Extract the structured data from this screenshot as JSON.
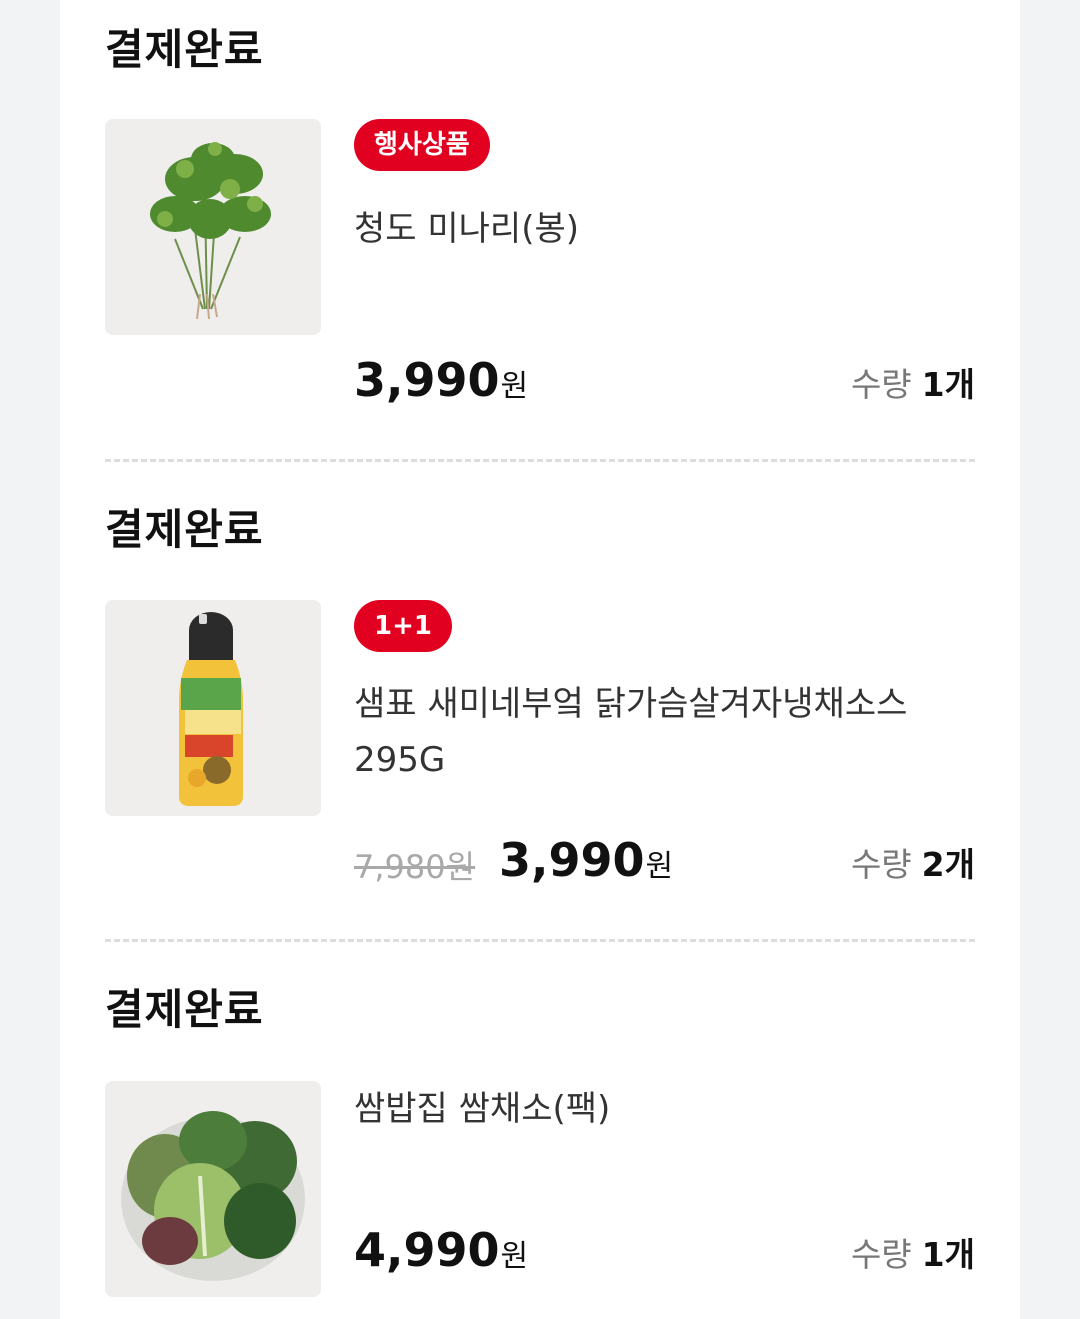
{
  "orders": [
    {
      "status": "결제완료",
      "badge": "행사상품",
      "name": "청도 미나리(봉)",
      "price": "3,990",
      "currency": "원",
      "qty_label": "수량",
      "qty": "1개",
      "image": "minari-bunch"
    },
    {
      "status": "결제완료",
      "badge": "1+1",
      "name": "샘표 새미네부엌 닭가슴살겨자냉채소스 295G",
      "original_price": "7,980원",
      "price": "3,990",
      "currency": "원",
      "qty_label": "수량",
      "qty": "2개",
      "image": "sauce-bottle"
    },
    {
      "status": "결제완료",
      "name": "쌈밥집 쌈채소(팩)",
      "price": "4,990",
      "currency": "원",
      "qty_label": "수량",
      "qty": "1개",
      "image": "lettuce-leaves"
    }
  ],
  "colors": {
    "badge": "#e1001f",
    "background": "#f2f3f5",
    "panel": "#ffffff"
  }
}
